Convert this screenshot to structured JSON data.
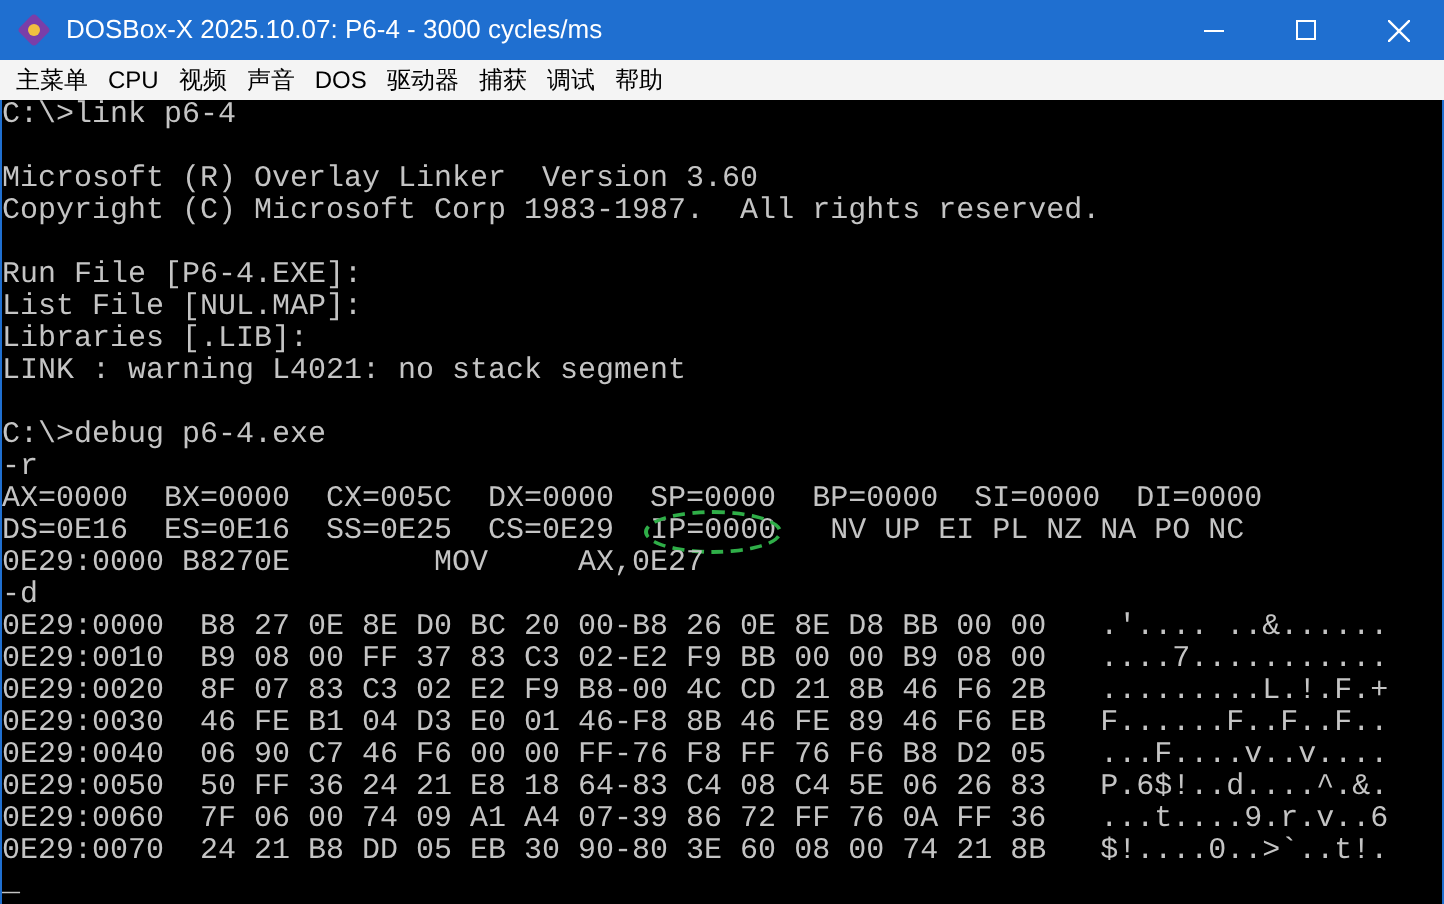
{
  "window": {
    "title": "DOSBox-X 2025.10.07: P6-4 - 3000 cycles/ms"
  },
  "menu": [
    "主菜单",
    "CPU",
    "视频",
    "声音",
    "DOS",
    "驱动器",
    "捕获",
    "调试",
    "帮助"
  ],
  "console": {
    "lines": [
      {
        "kind": "text",
        "text": "C:\\>link p6-4"
      },
      {
        "kind": "blank"
      },
      {
        "kind": "text",
        "text": "Microsoft (R) Overlay Linker  Version 3.60"
      },
      {
        "kind": "text",
        "text": "Copyright (C) Microsoft Corp 1983-1987.  All rights reserved."
      },
      {
        "kind": "blank"
      },
      {
        "kind": "text",
        "text": "Run File [P6-4.EXE]:"
      },
      {
        "kind": "text",
        "text": "List File [NUL.MAP]:"
      },
      {
        "kind": "text",
        "text": "Libraries [.LIB]:"
      },
      {
        "kind": "text",
        "text": "LINK : warning L4021: no stack segment"
      },
      {
        "kind": "blank"
      },
      {
        "kind": "text",
        "text": "C:\\>debug p6-4.exe"
      },
      {
        "kind": "text",
        "text": "-r"
      },
      {
        "kind": "text",
        "text": "AX=0000  BX=0000  CX=005C  DX=0000  SP=0000  BP=0000  SI=0000  DI=0000"
      },
      {
        "kind": "segmented",
        "segments": [
          {
            "text": "DS=0E16  ES=0E16  SS=0E25  CS=0E29  ",
            "circled": false
          },
          {
            "text": "IP=0000",
            "circled": true
          },
          {
            "text": "   NV UP EI PL NZ NA PO NC",
            "circled": false
          }
        ]
      },
      {
        "kind": "text",
        "text": "0E29:0000 B8270E        MOV     AX,0E27"
      },
      {
        "kind": "text",
        "text": "-d"
      },
      {
        "kind": "text",
        "text": "0E29:0000  B8 27 0E 8E D0 BC 20 00-B8 26 0E 8E D8 BB 00 00   .'.... ..&......"
      },
      {
        "kind": "text",
        "text": "0E29:0010  B9 08 00 FF 37 83 C3 02-E2 F9 BB 00 00 B9 08 00   ....7..........."
      },
      {
        "kind": "text",
        "text": "0E29:0020  8F 07 83 C3 02 E2 F9 B8-00 4C CD 21 8B 46 F6 2B   .........L.!.F.+"
      },
      {
        "kind": "text",
        "text": "0E29:0030  46 FE B1 04 D3 E0 01 46-F8 8B 46 FE 89 46 F6 EB   F......F..F..F.."
      },
      {
        "kind": "text",
        "text": "0E29:0040  06 90 C7 46 F6 00 00 FF-76 F8 FF 76 F6 B8 D2 05   ...F....v..v...."
      },
      {
        "kind": "text",
        "text": "0E29:0050  50 FF 36 24 21 E8 18 64-83 C4 08 C4 5E 06 26 83   P.6$!..d....^.&."
      },
      {
        "kind": "text",
        "text": "0E29:0060  7F 06 00 74 09 A1 A4 07-39 86 72 FF 76 0A FF 36   ...t....9.r.v..6"
      },
      {
        "kind": "text",
        "text": "0E29:0070  24 21 B8 DD 05 EB 30 90-80 3E 60 08 00 74 21 8B   $!....0..>`..t!."
      },
      {
        "kind": "cursor",
        "text": "_"
      }
    ]
  }
}
